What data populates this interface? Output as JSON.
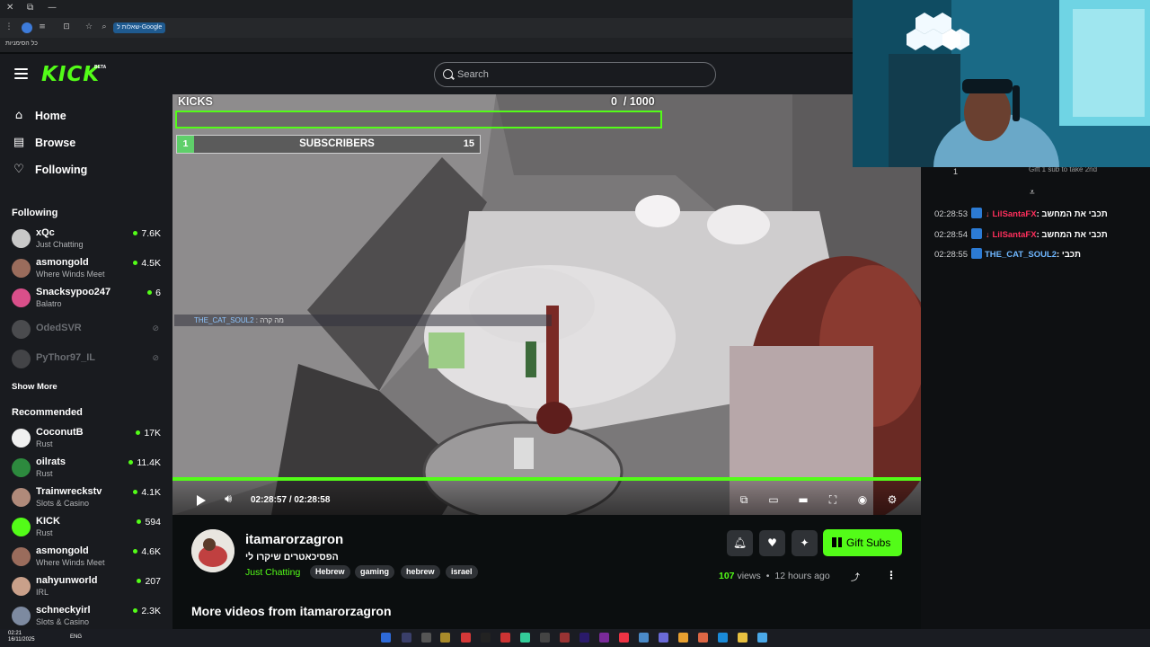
{
  "browser": {
    "chip_label": "שאלות ל-Google",
    "bookmarks_label": "כל הסימניות"
  },
  "header": {
    "logo": "KICK",
    "logo_badge": "BETA",
    "search_placeholder": "Search"
  },
  "nav": [
    {
      "label": "Home",
      "icon": "home-icon"
    },
    {
      "label": "Browse",
      "icon": "browse-icon"
    },
    {
      "label": "Following",
      "icon": "heart-icon"
    }
  ],
  "following": {
    "title": "Following",
    "channels": [
      {
        "name": "xQc",
        "category": "Just Chatting",
        "viewers": "7.6K",
        "avatar_color": "#c8c8c8",
        "live": true
      },
      {
        "name": "asmongold",
        "category": "Where Winds Meet",
        "viewers": "4.5K",
        "avatar_color": "#9a6c5c",
        "live": true
      },
      {
        "name": "Snacksypoo247",
        "category": "Balatro",
        "viewers": "6",
        "avatar_color": "#d94f8a",
        "live": true
      },
      {
        "name": "OdedSVR",
        "category": "",
        "viewers": "",
        "avatar_color": "#888888",
        "live": false
      },
      {
        "name": "PyThor97_IL",
        "category": "",
        "viewers": "",
        "avatar_color": "#777777",
        "live": false
      }
    ],
    "show_more": "Show More"
  },
  "recommended": {
    "title": "Recommended",
    "channels": [
      {
        "name": "CoconutB",
        "category": "Rust",
        "viewers": "17K",
        "avatar_color": "#f0f0f0"
      },
      {
        "name": "oilrats",
        "category": "Rust",
        "viewers": "11.4K",
        "avatar_color": "#2d8a3e"
      },
      {
        "name": "Trainwreckstv",
        "category": "Slots & Casino",
        "viewers": "4.1K",
        "avatar_color": "#b08a7a"
      },
      {
        "name": "KICK",
        "category": "Rust",
        "viewers": "594",
        "avatar_color": "#53fc18"
      },
      {
        "name": "asmongold",
        "category": "Where Winds Meet",
        "viewers": "4.6K",
        "avatar_color": "#9a6c5c"
      },
      {
        "name": "nahyunworld",
        "category": "IRL",
        "viewers": "207",
        "avatar_color": "#c9a08a"
      },
      {
        "name": "schneckyirl",
        "category": "Slots & Casino",
        "viewers": "2.3K",
        "avatar_color": "#7d8aa0"
      }
    ]
  },
  "overlay": {
    "kicks_label": "KICKS",
    "kicks_count": "0",
    "kicks_goal": "/ 1000",
    "kicks_progress": 0,
    "subs_index": "1",
    "subs_label": "SUBSCRIBERS",
    "subs_count": "15",
    "chat_user": "THE_CAT_SOUL2",
    "chat_text": ": מה קרה"
  },
  "player": {
    "time_current": "02:28:57",
    "time_separator": "/",
    "time_total": "02:28:58",
    "progress": 1.0
  },
  "stream": {
    "streamer": "itamarorzagron",
    "title": "הפסיכאטרים שיקרו לי",
    "category": "Just Chatting",
    "tags": [
      "Hebrew",
      "gaming",
      "hebrew",
      "israel"
    ],
    "gift_label": "Gift Subs",
    "views_count": "107",
    "views_label": "views",
    "age": "12 hours ago",
    "more_videos": "More videos from itamarorzagron"
  },
  "chat": {
    "pinned_count": "1",
    "pinned_text": "Gift 1 sub to take 2nd",
    "messages": [
      {
        "time": "02:28:53",
        "user": "LilSantaFX",
        "user_color": "#ff2f5c",
        "text": "תכבי את המחשב",
        "arrow": true
      },
      {
        "time": "02:28:54",
        "user": "LilSantaFX",
        "user_color": "#ff2f5c",
        "text": "תכבי את המחשב",
        "arrow": true
      },
      {
        "time": "02:28:55",
        "user": "THE_CAT_SOUL2",
        "user_color": "#6fb7ff",
        "text": "תכבי",
        "arrow": false
      }
    ]
  },
  "taskbar": {
    "time": "02:21",
    "date": "16/11/2025",
    "lang": "ENG"
  },
  "colors": {
    "brand": "#53fc18",
    "background": "#0b0e0f",
    "panel": "#191b1f"
  }
}
